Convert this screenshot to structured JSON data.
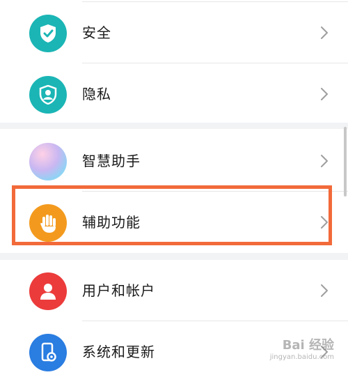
{
  "settings": {
    "group1": [
      {
        "label": "安全",
        "icon": "shield-check-icon",
        "color": "#1bb5b5"
      },
      {
        "label": "隐私",
        "icon": "privacy-shield-user-icon",
        "color": "#1bb5b5"
      }
    ],
    "group2": [
      {
        "label": "智慧助手",
        "icon": "smart-assistant-orb-icon",
        "color": "#c9b7f2"
      },
      {
        "label": "辅助功能",
        "icon": "hand-icon",
        "color": "#f39a1e",
        "highlighted": true
      }
    ],
    "group3": [
      {
        "label": "用户和帐户",
        "icon": "user-account-icon",
        "color": "#ec3b3b"
      },
      {
        "label": "系统和更新",
        "icon": "phone-settings-icon",
        "color": "#2a7de1"
      }
    ]
  },
  "highlight_color": "#f26a3a",
  "watermark": {
    "main": "Bai 经验",
    "sub": "jingyan.baidu.com"
  }
}
